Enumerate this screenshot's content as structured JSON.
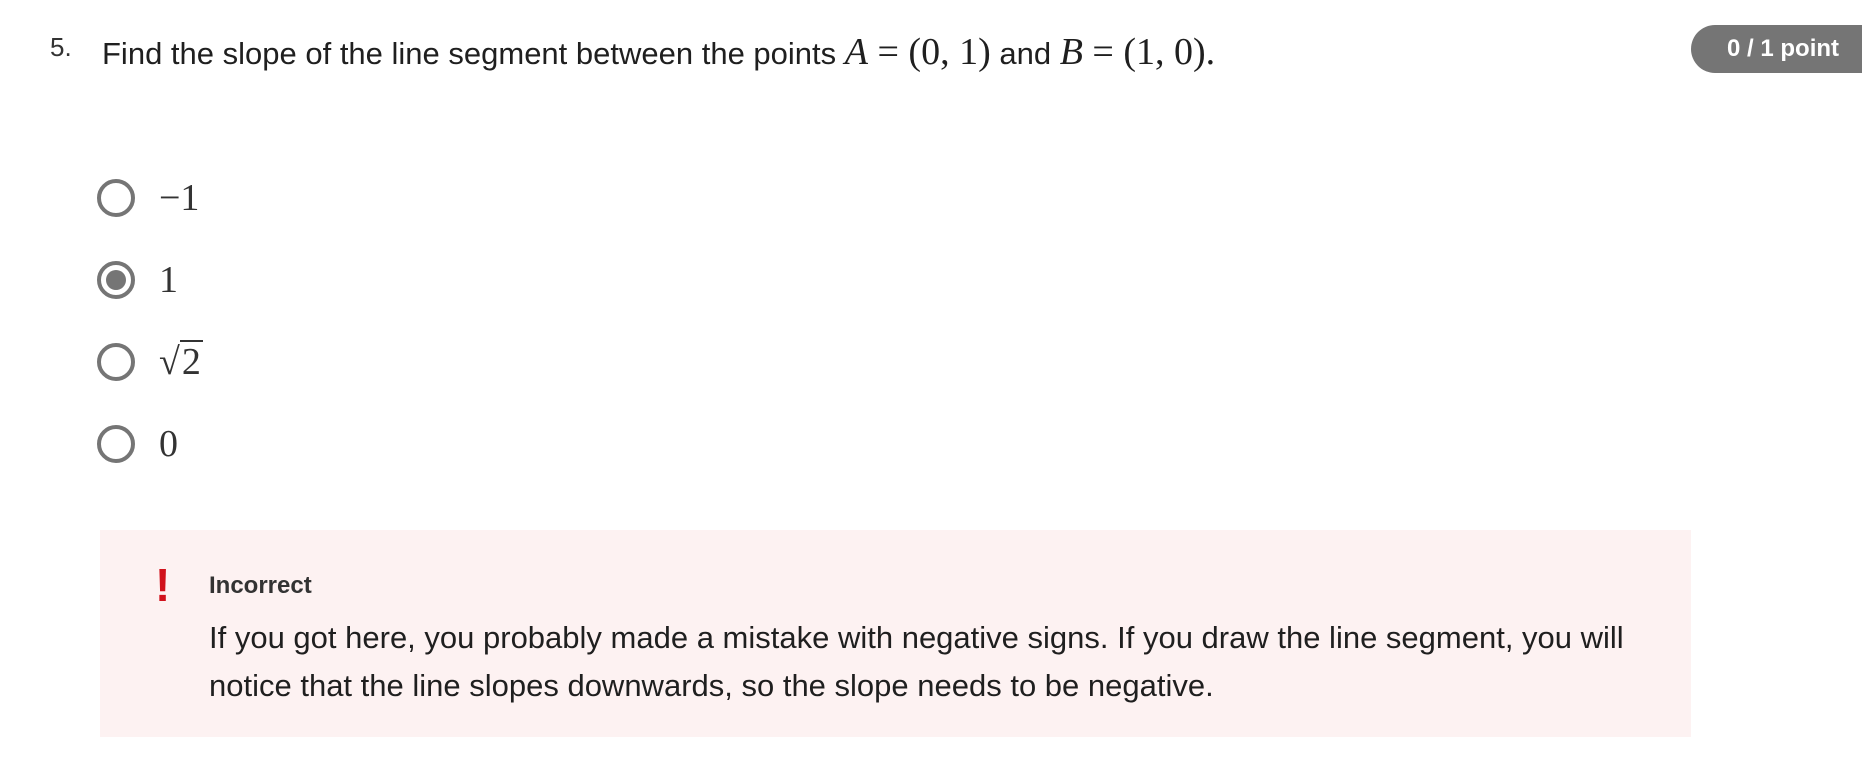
{
  "question": {
    "number": "5.",
    "text_before": "Find the slope of the line segment between the points ",
    "point_a_var": "A",
    "point_a_coords": "= (0, 1)",
    "conjunction": " and ",
    "point_b_var": "B",
    "point_b_coords": "= (1, 0).",
    "points_badge": "0 / 1 point"
  },
  "options": [
    {
      "label": "−1",
      "selected": false
    },
    {
      "label": "1",
      "selected": true
    },
    {
      "label_radical": "√",
      "label_radicand": "2",
      "selected": false
    },
    {
      "label": "0",
      "selected": false
    }
  ],
  "feedback": {
    "icon": "!",
    "icon_name": "exclamation-icon",
    "title": "Incorrect",
    "body": "If you got here, you probably made a mistake with negative signs. If you draw the line segment, you will notice that the line slopes downwards, so the slope needs to be negative.",
    "background_color": "#fdf2f2",
    "icon_color": "#d1121c"
  },
  "colors": {
    "badge_bg": "#757575",
    "radio": "#757575"
  }
}
